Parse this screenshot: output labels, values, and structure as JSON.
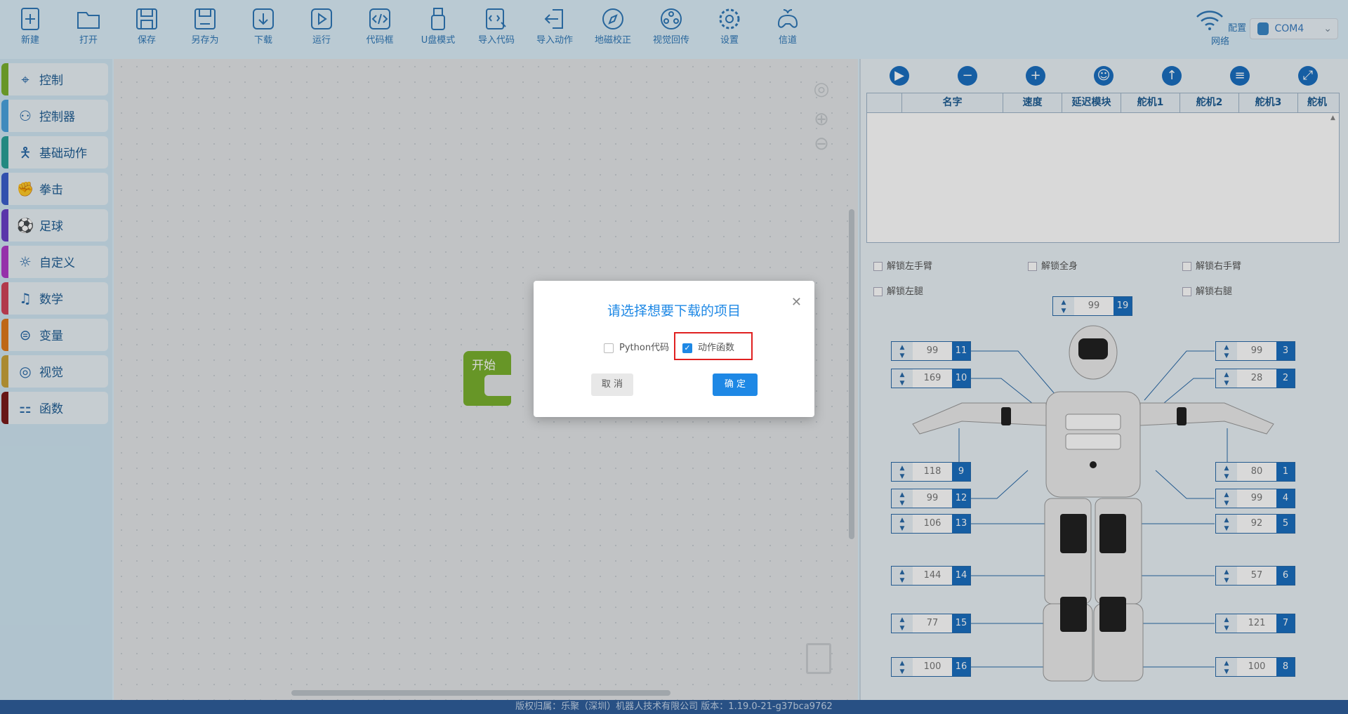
{
  "toolbar": {
    "items": [
      {
        "label": "新建",
        "icon": "new-file-icon"
      },
      {
        "label": "打开",
        "icon": "folder-icon"
      },
      {
        "label": "保存",
        "icon": "save-icon"
      },
      {
        "label": "另存为",
        "icon": "save-as-icon"
      },
      {
        "label": "下载",
        "icon": "download-icon"
      },
      {
        "label": "运行",
        "icon": "play-icon"
      },
      {
        "label": "代码框",
        "icon": "code-icon"
      },
      {
        "label": "U盘模式",
        "icon": "usb-icon"
      },
      {
        "label": "导入代码",
        "icon": "import-code-icon"
      },
      {
        "label": "导入动作",
        "icon": "import-action-icon"
      },
      {
        "label": "地磁校正",
        "icon": "compass-icon"
      },
      {
        "label": "视觉回传",
        "icon": "camera-reel-icon"
      },
      {
        "label": "设置",
        "icon": "gear-icon"
      },
      {
        "label": "信道",
        "icon": "gamepad-icon"
      }
    ],
    "network_label": "配置网络",
    "com_port": "COM4"
  },
  "sidebar": {
    "categories": [
      {
        "label": "控制",
        "color": "#7ab12e"
      },
      {
        "label": "控制器",
        "color": "#4aa3df"
      },
      {
        "label": "基础动作",
        "color": "#2aa198"
      },
      {
        "label": "拳击",
        "color": "#3a5fcd"
      },
      {
        "label": "足球",
        "color": "#6a3fc8"
      },
      {
        "label": "自定义",
        "color": "#b03ac8"
      },
      {
        "label": "数学",
        "color": "#d0435a"
      },
      {
        "label": "变量",
        "color": "#e07a1a"
      },
      {
        "label": "视觉",
        "color": "#c8a33a"
      },
      {
        "label": "函数",
        "color": "#7a1a1a"
      }
    ]
  },
  "workspace": {
    "start_block_label": "开始"
  },
  "motion_table": {
    "columns": [
      "",
      "名字",
      "速度",
      "延迟模块",
      "舵机1",
      "舵机2",
      "舵机3",
      "舵机"
    ]
  },
  "locks": {
    "left_arm": "解锁左手臂",
    "whole_body": "解锁全身",
    "right_arm": "解锁右手臂",
    "left_leg": "解锁左腿",
    "right_leg": "解锁右腿"
  },
  "servos": {
    "s19": {
      "value": "99",
      "id": "19"
    },
    "s11": {
      "value": "99",
      "id": "11"
    },
    "s10": {
      "value": "169",
      "id": "10"
    },
    "s9": {
      "value": "118",
      "id": "9"
    },
    "s12": {
      "value": "99",
      "id": "12"
    },
    "s13": {
      "value": "106",
      "id": "13"
    },
    "s14": {
      "value": "144",
      "id": "14"
    },
    "s15": {
      "value": "77",
      "id": "15"
    },
    "s16": {
      "value": "100",
      "id": "16"
    },
    "s3": {
      "value": "99",
      "id": "3"
    },
    "s2": {
      "value": "28",
      "id": "2"
    },
    "s1": {
      "value": "80",
      "id": "1"
    },
    "s4": {
      "value": "99",
      "id": "4"
    },
    "s5": {
      "value": "92",
      "id": "5"
    },
    "s6": {
      "value": "57",
      "id": "6"
    },
    "s7": {
      "value": "121",
      "id": "7"
    },
    "s8": {
      "value": "100",
      "id": "8"
    }
  },
  "dialog": {
    "title": "请选择想要下载的项目",
    "option_python": "Python代码",
    "option_python_checked": false,
    "option_action": "动作函数",
    "option_action_checked": true,
    "cancel": "取 消",
    "ok": "确 定"
  },
  "statusbar": {
    "text": "版权归属：乐聚（深圳）机器人技术有限公司 版本：1.19.0-21-g37bca9762"
  }
}
